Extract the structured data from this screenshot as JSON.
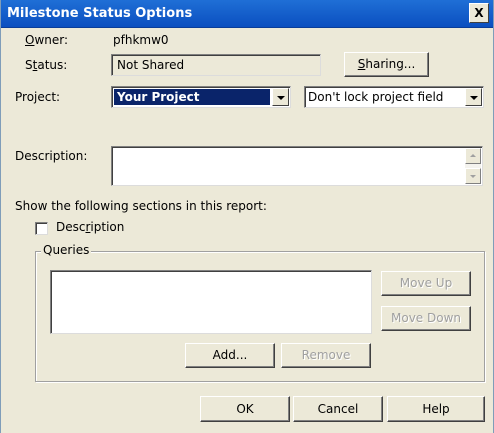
{
  "window": {
    "title": "Milestone Status Options",
    "close_symbol": "X"
  },
  "owner": {
    "label": "Owner:",
    "value": "pfhkmw0"
  },
  "status": {
    "label": "Status:",
    "value": "Not Shared",
    "sharing_button": "Sharing..."
  },
  "project": {
    "label": "Project:",
    "selected": "Your Project",
    "lock_option": "Don't lock project field"
  },
  "description": {
    "label": "Description:",
    "value": ""
  },
  "sections": {
    "heading": "Show the following sections in this report:",
    "description_checkbox": {
      "label": "Description",
      "checked": false
    }
  },
  "queries": {
    "legend": "Queries",
    "items": [],
    "move_up": "Move Up",
    "move_down": "Move Down",
    "add": "Add...",
    "remove": "Remove"
  },
  "footer": {
    "ok": "OK",
    "cancel": "Cancel",
    "help": "Help"
  }
}
